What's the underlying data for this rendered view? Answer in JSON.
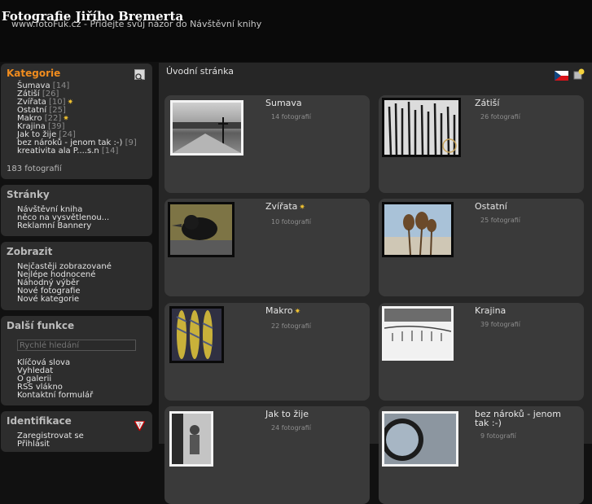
{
  "header": {
    "title": "Fotografie Jiřího Bremerta",
    "tagline": "www.fotoFuk.cz - Přidejte svůj názor do Návštěvní knihy"
  },
  "sidebar": {
    "kategorie": {
      "title": "Kategorie",
      "items": [
        {
          "label": "Šumava",
          "count": "[14]"
        },
        {
          "label": "Zátiší",
          "count": "[26]"
        },
        {
          "label": "Zvířata",
          "count": "[10]",
          "star": "✷"
        },
        {
          "label": "Ostatní",
          "count": "[25]"
        },
        {
          "label": "Makro",
          "count": "[22]",
          "star": "✷"
        },
        {
          "label": "Krajina",
          "count": "[39]"
        },
        {
          "label": "Jak to žije",
          "count": "[24]"
        },
        {
          "label": "bez nároků - jenom tak :-)",
          "count": "[9]"
        },
        {
          "label": "kreativita ala P....s.n",
          "count": "[14]"
        }
      ],
      "total": "183 fotografií"
    },
    "stranky": {
      "title": "Stránky",
      "items": [
        "Návštěvní kniha",
        "něco na vysvětlenou...",
        "Reklamní Bannery"
      ]
    },
    "zobrazit": {
      "title": "Zobrazit",
      "items": [
        "Nejčastěji zobrazované",
        "Nejlépe hodnocené",
        "Náhodný výběr",
        "Nové fotografie",
        "Nové kategorie"
      ]
    },
    "dalsi": {
      "title": "Další funkce",
      "search_placeholder": "Rychlé hledání",
      "items": [
        "Klíčová slova",
        "Vyhledat",
        "O galerii",
        "RSS vlákno",
        "Kontaktní formulář"
      ]
    },
    "identifikace": {
      "title": "Identifikace",
      "items": [
        "Zaregistrovat se",
        "Přihlásit"
      ]
    }
  },
  "main": {
    "title": "Úvodní stránka",
    "galleries": [
      {
        "name": "Sumava",
        "count": "14 fotografií"
      },
      {
        "name": "Zátiší",
        "count": "26 fotografií"
      },
      {
        "name": "Zvířata",
        "count": "10 fotografií",
        "star": "✷"
      },
      {
        "name": "Ostatní",
        "count": "25 fotografií"
      },
      {
        "name": "Makro",
        "count": "22 fotografií",
        "star": "✷"
      },
      {
        "name": "Krajina",
        "count": "39 fotografií"
      },
      {
        "name": "Jak to žije",
        "count": "24 fotografií"
      },
      {
        "name": "bez nároků - jenom tak :-)",
        "count": "9 fotografií"
      }
    ]
  }
}
